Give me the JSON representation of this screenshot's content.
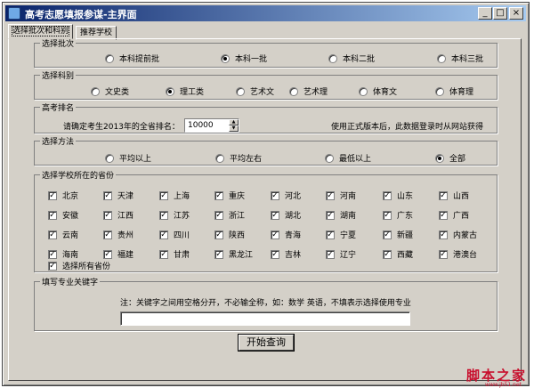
{
  "window": {
    "title": "高考志愿填报参谋-主界面",
    "minimize": "_",
    "maximize": "□",
    "close": "×"
  },
  "tabs": [
    "选择批次和科别",
    "推荐学校"
  ],
  "batch": {
    "legend": "选择批次",
    "options": [
      "本科提前批",
      "本科一批",
      "本科二批",
      "本科三批"
    ],
    "selected": "本科一批"
  },
  "subject": {
    "legend": "选择科别",
    "options": [
      "文史类",
      "理工类",
      "艺术文",
      "艺术理",
      "体育文",
      "体育理"
    ],
    "selected": "理工类"
  },
  "rank": {
    "legend": "高考排名",
    "prompt": "请确定考生2013年的全省排名：",
    "value": "10000",
    "note": "使用正式版本后，此数据登录时从网站获得"
  },
  "method": {
    "legend": "选择方法",
    "options": [
      "平均以上",
      "平均左右",
      "最低以上",
      "全部"
    ],
    "selected": "全部"
  },
  "provinces": {
    "legend": "选择学校所在的省份",
    "items": [
      "北京",
      "天津",
      "上海",
      "重庆",
      "河北",
      "河南",
      "山东",
      "山西",
      "安徽",
      "江西",
      "江苏",
      "浙江",
      "湖北",
      "湖南",
      "广东",
      "广西",
      "云南",
      "贵州",
      "四川",
      "陕西",
      "青海",
      "宁夏",
      "新疆",
      "内蒙古",
      "海南",
      "福建",
      "甘肃",
      "黑龙江",
      "吉林",
      "辽宁",
      "西藏",
      "港澳台"
    ],
    "select_all": "选择所有省份"
  },
  "keyword": {
    "legend": "填写专业关键字",
    "note": "注：关键字之间用空格分开，不必输全称，如：数学 英语，不填表示选择使用专业",
    "value": ""
  },
  "query_button": "开始查询",
  "watermark": {
    "text": "脚本之家",
    "url": "www.jb51.net"
  }
}
